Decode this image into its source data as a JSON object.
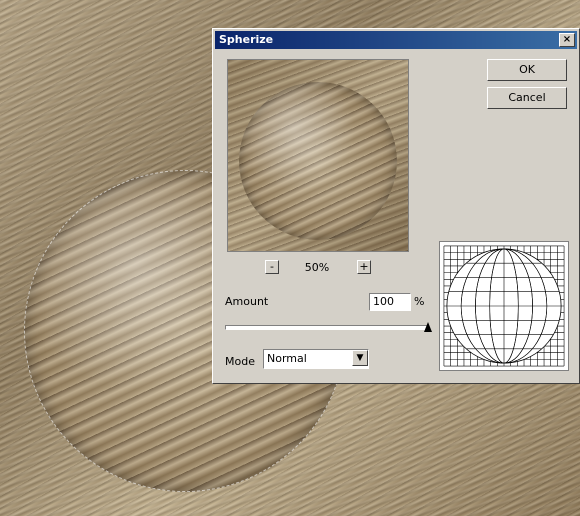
{
  "window": {
    "title": "Spherize",
    "close_glyph": "×"
  },
  "buttons": {
    "ok": "OK",
    "cancel": "Cancel"
  },
  "preview": {
    "zoom_out_label": "-",
    "zoom_in_label": "+",
    "zoom": "50%"
  },
  "amount": {
    "label": "Amount",
    "value": "100",
    "unit": "%",
    "slider_fraction": 1.0
  },
  "mode": {
    "label": "Mode",
    "selected": "Normal",
    "dropdown_icon": "▼"
  },
  "icons": {
    "close": "close-icon",
    "dropdown": "chevron-down-icon"
  },
  "colors": {
    "dialog_bg": "#d4d0c8",
    "title_bar_start": "#0a246a",
    "title_bar_end": "#3a6ea5"
  }
}
